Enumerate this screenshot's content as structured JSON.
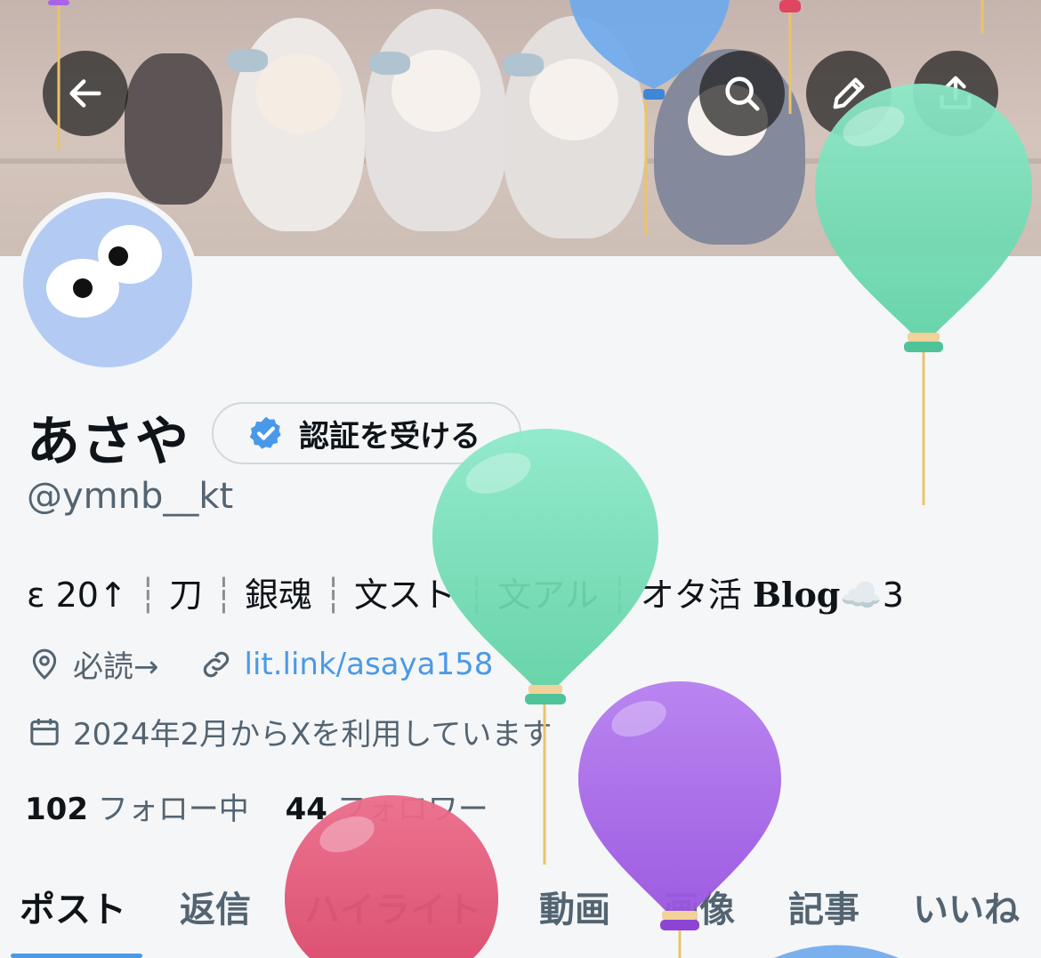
{
  "header": {
    "back_icon": "arrow-left-icon",
    "search_icon": "search-icon",
    "edit_icon": "pencil-icon",
    "share_icon": "share-icon"
  },
  "profile": {
    "name": "あさや",
    "verify_label": "認証を受ける",
    "handle": "@ymnb__kt",
    "bio": {
      "parts": [
        "ε 20↑",
        "刀",
        "銀魂",
        "文スト",
        "文アル",
        "オタ活 "
      ],
      "blog": "Blog",
      "tail": "☁️3"
    },
    "location": "必読→",
    "website": "lit.link/asaya158",
    "joined": "2024年2月からXを利用しています",
    "following_count": "102",
    "following_label": "フォロー中",
    "followers_count": "44",
    "followers_label": "フォロワー"
  },
  "tabs": [
    "ポスト",
    "返信",
    "ハイライト",
    "動画",
    "画像",
    "記事",
    "いいね"
  ],
  "colors": {
    "accent": "#4a99e9",
    "verify_badge": "#4a99e9",
    "avatar_bg": "#b3cbf2",
    "balloon_green": "#7fe3c0",
    "balloon_purple": "#a764e8",
    "balloon_red": "#e35a7a",
    "balloon_blue": "#6ea9ec"
  }
}
